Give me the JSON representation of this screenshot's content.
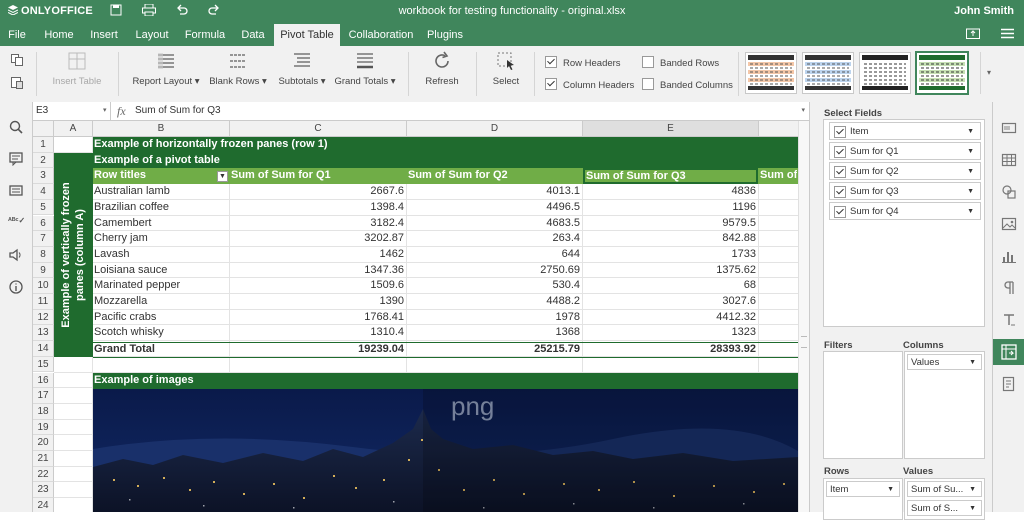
{
  "app": {
    "logo": "ONLYOFFICE",
    "document_title": "workbook for testing functionality - original.xlsx",
    "user": "John Smith"
  },
  "menu": [
    "File",
    "Home",
    "Insert",
    "Layout",
    "Formula",
    "Data",
    "Pivot Table",
    "Collaboration",
    "Plugins"
  ],
  "ribbon": {
    "insert_table": "Insert Table",
    "report_layout": "Report Layout",
    "blank_rows": "Blank Rows",
    "subtotals": "Subtotals",
    "grand_totals": "Grand Totals",
    "refresh": "Refresh",
    "select": "Select",
    "row_headers": "Row Headers",
    "column_headers": "Column Headers",
    "banded_rows": "Banded Rows",
    "banded_columns": "Banded Columns"
  },
  "formula_bar": {
    "cell_ref": "E3",
    "fx": "fx",
    "content": "Sum of Sum for Q3"
  },
  "columns": [
    "A",
    "B",
    "C",
    "D",
    "E"
  ],
  "rows": [
    "1",
    "2",
    "3",
    "4",
    "5",
    "6",
    "7",
    "8",
    "9",
    "10",
    "11",
    "12",
    "13",
    "14",
    "15",
    "16",
    "17",
    "18",
    "19",
    "20",
    "21",
    "22",
    "23",
    "24"
  ],
  "sheet": {
    "row1": "Example of horizontally frozen panes (row 1)",
    "row2": "Example of a pivot table",
    "vertical_label": "Example of vertically frozen panes (column A)",
    "headers": [
      "Row titles",
      "Sum of Sum for Q1",
      "Sum of  Sum for Q2",
      "Sum of Sum for Q3",
      "Sum of"
    ],
    "data": [
      [
        "Australian lamb",
        "2667.6",
        "4013.1",
        "4836"
      ],
      [
        "Brazilian coffee",
        "1398.4",
        "4496.5",
        "1196"
      ],
      [
        "Camembert",
        "3182.4",
        "4683.5",
        "9579.5"
      ],
      [
        "Cherry jam",
        "3202.87",
        "263.4",
        "842.88"
      ],
      [
        "Lavash",
        "1462",
        "644",
        "1733"
      ],
      [
        "Loisiana sauce",
        "1347.36",
        "2750.69",
        "1375.62"
      ],
      [
        "Marinated pepper",
        "1509.6",
        "530.4",
        "68"
      ],
      [
        "Mozzarella",
        "1390",
        "4488.2",
        "3027.6"
      ],
      [
        "Pacific crabs",
        "1768.41",
        "1978",
        "4412.32"
      ],
      [
        "Scotch whisky",
        "1310.4",
        "1368",
        "1323"
      ]
    ],
    "grand_total": [
      "Grand Total",
      "19239.04",
      "25215.79",
      "28393.92"
    ],
    "row16": "Example of images",
    "image_watermark": "png"
  },
  "pivot_panel": {
    "select_fields": "Select Fields",
    "fields": [
      "Item",
      "Sum for Q1",
      "Sum for Q2",
      "Sum for Q3",
      "Sum for Q4"
    ],
    "filters": "Filters",
    "columns_title": "Columns",
    "columns_items": [
      "Values"
    ],
    "rows_title": "Rows",
    "rows_items": [
      "Item"
    ],
    "values_title": "Values",
    "values_items": [
      "Sum of Su...",
      "Sum of S..."
    ]
  },
  "colors": {
    "accent": "#40865c",
    "pivot_dark": "#1f6b2e",
    "pivot_header": "#70ad47"
  }
}
